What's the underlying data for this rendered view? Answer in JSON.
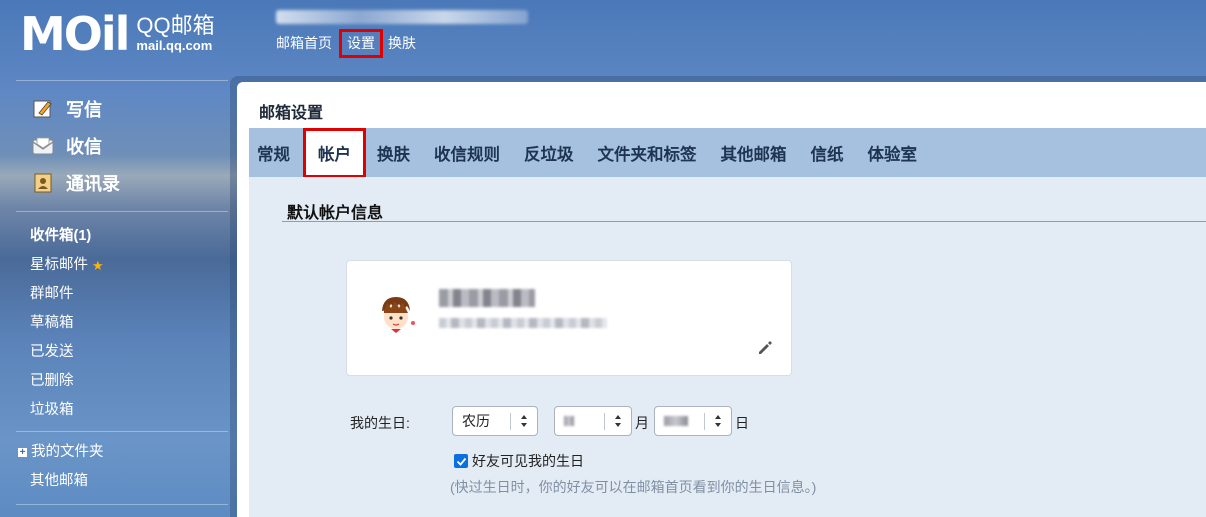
{
  "header": {
    "logo_mark": "MOil",
    "logo_title": "QQ邮箱",
    "logo_domain": "mail.qq.com",
    "nav": [
      {
        "label": "邮箱首页"
      },
      {
        "label": "设置"
      },
      {
        "label": "换肤"
      }
    ]
  },
  "sidebar": {
    "primary": [
      {
        "label": "写信",
        "icon": "compose-icon"
      },
      {
        "label": "收信",
        "icon": "inbox-envelope-icon"
      },
      {
        "label": "通讯录",
        "icon": "contacts-book-icon"
      }
    ],
    "folders": [
      {
        "label": "收件箱(1)"
      },
      {
        "label": "星标邮件"
      },
      {
        "label": "群邮件"
      },
      {
        "label": "草稿箱"
      },
      {
        "label": "已发送"
      },
      {
        "label": "已删除"
      },
      {
        "label": "垃圾箱"
      }
    ],
    "my_folders": "我的文件夹",
    "other_mailbox": "其他邮箱"
  },
  "main": {
    "title": "邮箱设置",
    "tabs": [
      {
        "label": "常规"
      },
      {
        "label": "帐户"
      },
      {
        "label": "换肤"
      },
      {
        "label": "收信规则"
      },
      {
        "label": "反垃圾"
      },
      {
        "label": "文件夹和标签"
      },
      {
        "label": "其他邮箱"
      },
      {
        "label": "信纸"
      },
      {
        "label": "体验室"
      }
    ],
    "active_tab": "帐户",
    "section_title": "默认帐户信息",
    "birthday": {
      "label": "我的生日:",
      "calendar_type": "农历",
      "month_unit": "月",
      "day_unit": "日",
      "visible_checkbox_label": "好友可见我的生日",
      "visible_checked": true,
      "hint": "(快过生日时，你的好友可以在邮箱首页看到你的生日信息。)"
    }
  },
  "colors": {
    "highlight_red": "#e00000",
    "tab_bar": "#a6c1e0",
    "content_bg": "#e3ebf5",
    "checkbox_blue": "#0b6fe0"
  }
}
